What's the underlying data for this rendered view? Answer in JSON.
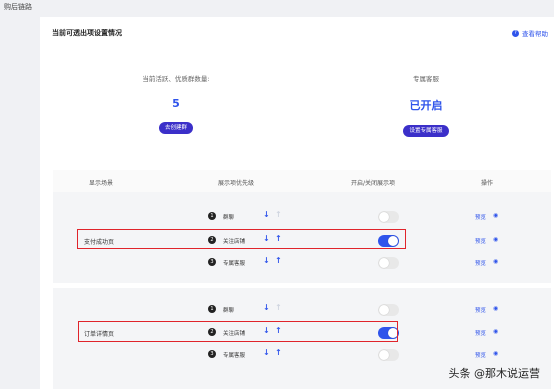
{
  "page": {
    "title": "购后链路"
  },
  "header": {
    "section_title": "当前可透出项设置情况",
    "help_label": "查看帮助"
  },
  "stats": [
    {
      "label": "当前活跃、优质群数量:",
      "value": "5",
      "button": "去创建群"
    },
    {
      "label": "专属客服",
      "value": "已开启",
      "button": "设置专属客服"
    }
  ],
  "table": {
    "headers": [
      "显示场景",
      "展示项优先级",
      "开启/关闭展示项",
      "操作"
    ],
    "groups": [
      {
        "scene": "支付成功页",
        "rows": [
          {
            "num": "1",
            "name": "群聊",
            "up_enabled": false,
            "enabled": false,
            "action": "预览"
          },
          {
            "num": "2",
            "name": "关注店铺",
            "up_enabled": true,
            "enabled": true,
            "action": "预览"
          },
          {
            "num": "3",
            "name": "专属客服",
            "up_enabled": true,
            "enabled": false,
            "action": "预览"
          }
        ]
      },
      {
        "scene": "订单详情页",
        "rows": [
          {
            "num": "1",
            "name": "群聊",
            "up_enabled": false,
            "enabled": false,
            "action": "预览"
          },
          {
            "num": "2",
            "name": "关注店铺",
            "up_enabled": true,
            "enabled": true,
            "action": "预览"
          },
          {
            "num": "3",
            "name": "专属客服",
            "up_enabled": true,
            "enabled": false,
            "action": "预览"
          }
        ]
      }
    ]
  },
  "watermark": "头条 @那木说运营",
  "colors": {
    "accent": "#2f54eb",
    "button": "#3b2fc9",
    "highlight": "#e0242b"
  },
  "icons": {
    "help": "question-circle-icon",
    "down": "arrow-down-icon",
    "up": "arrow-up-icon",
    "eye": "eye-icon"
  }
}
